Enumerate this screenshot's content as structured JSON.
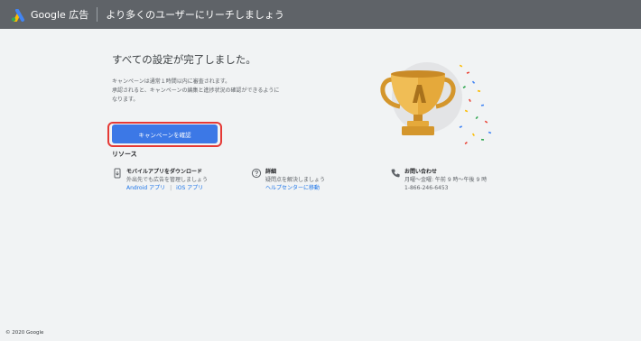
{
  "header": {
    "brand": "Google 広告",
    "tagline": "より多くのユーザーにリーチしましょう"
  },
  "main": {
    "headline": "すべての設定が完了しました。",
    "description_lines": [
      "キャンペーンは通常１時間以内に審査されます。",
      "承認されると、キャンペーンの編集と進捗状況の確認ができるように",
      "なります。"
    ],
    "cta_label": "キャンペーンを確認"
  },
  "resources": {
    "title": "リソース",
    "mobile": {
      "title": "モバイルアプリをダウンロード",
      "subtitle": "外出先でも広告を管理しましょう",
      "android_link": "Android アプリ",
      "separator": "|",
      "ios_link": "iOS アプリ"
    },
    "details": {
      "title": "詳細",
      "subtitle": "疑問点を解決しましょう",
      "link": "ヘルプセンターに移動"
    },
    "contact": {
      "title": "お問い合わせ",
      "hours": "月曜〜金曜: 午前 9 時〜午後 9 時",
      "phone": "1-866-246-6453"
    }
  },
  "footer": {
    "copyright": "© 2020 Google"
  },
  "colors": {
    "topbar": "#5f6368",
    "primary_button": "#3c78e6",
    "highlight_outline": "#e53935",
    "link": "#1a73e8",
    "trophy_gold": "#e5a93b"
  }
}
